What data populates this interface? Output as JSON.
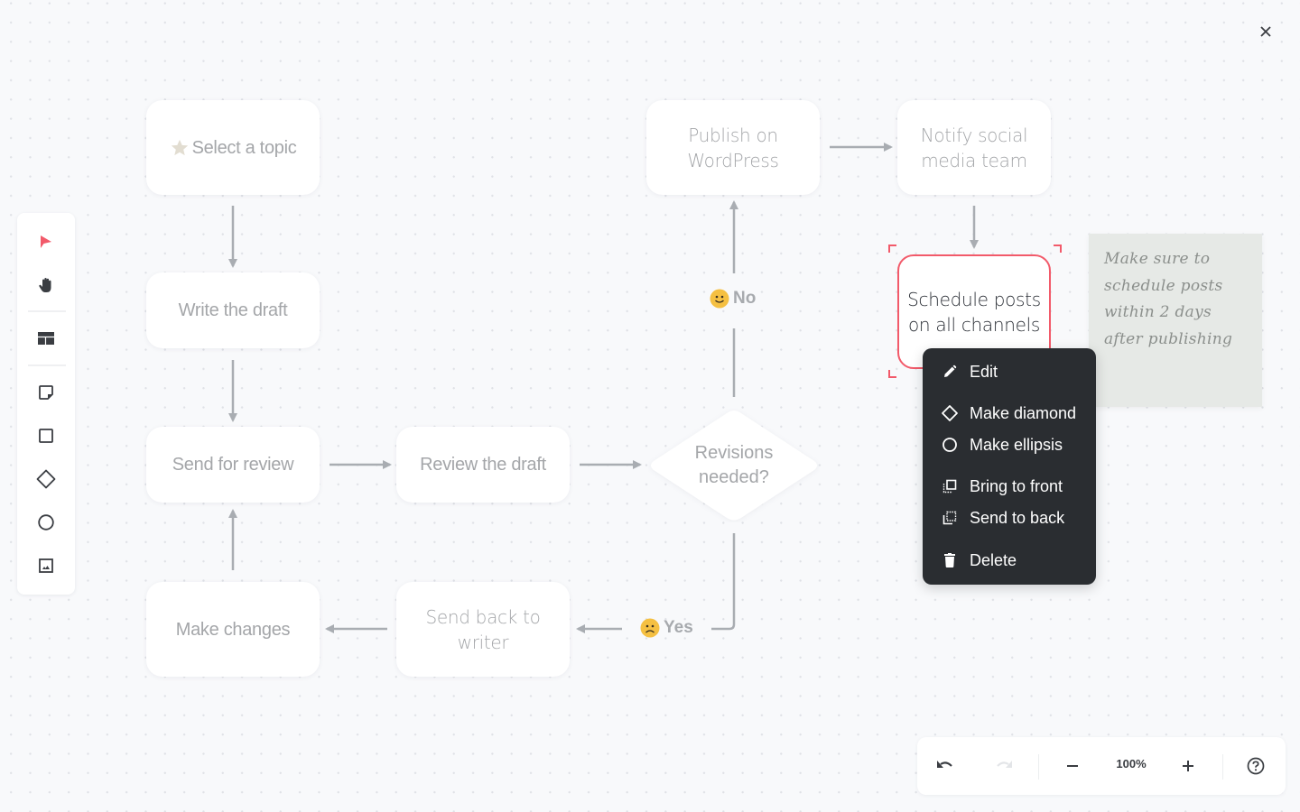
{
  "canvas": {
    "close_label": "close",
    "nodes": [
      {
        "id": "select-topic",
        "label": "Select a topic",
        "icon": "star-icon"
      },
      {
        "id": "write-draft",
        "label": "Write the draft"
      },
      {
        "id": "send-review",
        "label": "Send for review"
      },
      {
        "id": "review-draft",
        "label": "Review the draft"
      },
      {
        "id": "revisions",
        "label_lines": [
          "Revisions",
          "needed?"
        ],
        "shape": "diamond"
      },
      {
        "id": "publish",
        "label_lines": [
          "Publish on",
          "WordPress"
        ]
      },
      {
        "id": "notify",
        "label_lines": [
          "Notify social",
          "media team"
        ]
      },
      {
        "id": "schedule",
        "label_lines": [
          "Schedule posts",
          "on all channels"
        ],
        "selected": true
      },
      {
        "id": "send-back",
        "label_lines": [
          "Send back to",
          "writer"
        ]
      },
      {
        "id": "make-changes",
        "label": "Make changes"
      }
    ],
    "edge_labels": {
      "no": {
        "text": "No",
        "emoji": "smile-emoji"
      },
      "yes": {
        "text": "Yes",
        "emoji": "frown-emoji"
      }
    },
    "sticky_note": {
      "lines": [
        "Make sure to",
        "schedule posts",
        "within 2 days",
        "after publishing"
      ]
    },
    "colors": {
      "accent": "#f25a6a",
      "menu_bg": "#2a2d31",
      "sticky_bg": "#e6e9e6",
      "emoji": "#f5c042"
    }
  },
  "toolbar": {
    "tools": [
      {
        "name": "select",
        "icon": "pointer-icon",
        "active": true
      },
      {
        "name": "hand",
        "icon": "hand-icon"
      },
      {
        "name": "table",
        "icon": "table-icon"
      },
      {
        "name": "sticky-note",
        "icon": "sticky-note-icon"
      },
      {
        "name": "rectangle",
        "icon": "square-icon"
      },
      {
        "name": "diamond",
        "icon": "diamond-icon"
      },
      {
        "name": "ellipse",
        "icon": "circle-icon"
      },
      {
        "name": "image",
        "icon": "image-icon"
      }
    ]
  },
  "context_menu": {
    "items": [
      {
        "label": "Edit",
        "icon": "pencil-icon"
      },
      {
        "label": "Make diamond",
        "icon": "diamond-icon"
      },
      {
        "label": "Make ellipsis",
        "icon": "circle-icon"
      },
      {
        "label": "Bring to front",
        "icon": "bring-front-icon"
      },
      {
        "label": "Send to back",
        "icon": "send-back-icon"
      },
      {
        "label": "Delete",
        "icon": "trash-icon"
      }
    ]
  },
  "bottom_bar": {
    "zoom_level": "100%",
    "undo_enabled": true,
    "redo_enabled": false
  }
}
